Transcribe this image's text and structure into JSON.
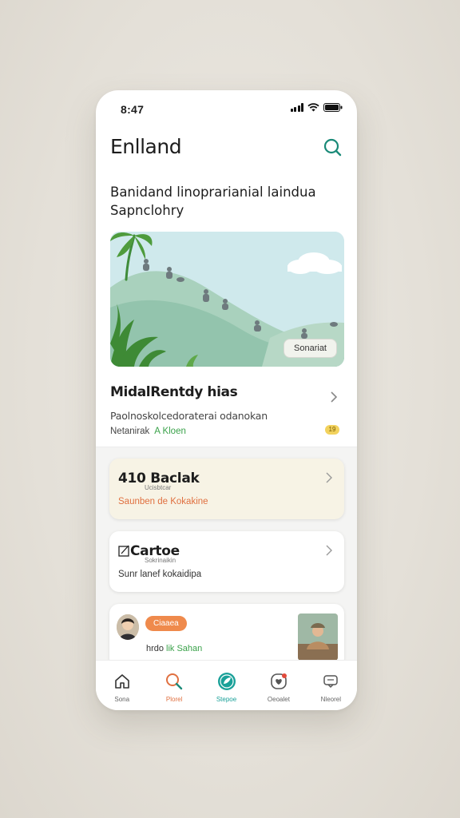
{
  "status_bar": {
    "time": "8:47"
  },
  "header": {
    "title": "Enlland"
  },
  "headline": {
    "line1": "Banidand linoprarianial laindua",
    "line2": "Sapnclohry"
  },
  "hero": {
    "button_label": "Sonariat"
  },
  "feature": {
    "title": "MidalRentdy hias",
    "description": "Paolnoskolcedoraterai odanokan",
    "meta": "Netanirak",
    "meta_tag": "A Kloen",
    "badge": "19"
  },
  "cards": [
    {
      "title": "410 Baclak",
      "subtitle": "Ucisbtcar",
      "description": "Saunben de Kokakine"
    },
    {
      "title": "Cartoe",
      "subtitle": "Sokrinaikin",
      "description": "Sunr lanef kokaidipa"
    }
  ],
  "card3": {
    "pill": "Ciaaea",
    "text": "hrdo",
    "text_green": "lik Sahan"
  },
  "tabs": [
    {
      "label": "Sona",
      "icon": "home-icon"
    },
    {
      "label": "Plorel",
      "icon": "search-icon"
    },
    {
      "label": "Stepoe",
      "icon": "leaf-badge-icon"
    },
    {
      "label": "Oeoalet",
      "icon": "heart-notification-icon"
    },
    {
      "label": "Nleorel",
      "icon": "chat-icon"
    }
  ],
  "colors": {
    "accent_teal": "#1aa199",
    "accent_orange": "#ef8a4c",
    "accent_green": "#3aa24a",
    "hero_sky": "#cfe9ec"
  }
}
